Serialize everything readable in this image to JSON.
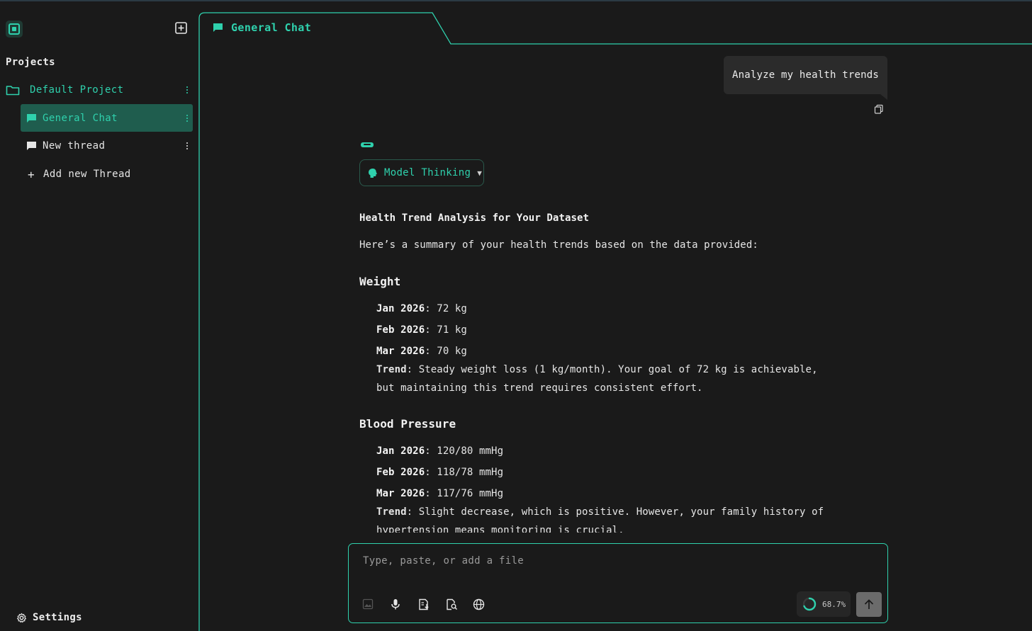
{
  "app": {
    "logo_icon": "chip-icon",
    "new_chat_icon": "add-square-icon",
    "accent_color": "#2fd1ad"
  },
  "sidebar": {
    "projects_heading": "Projects",
    "project": {
      "label": "Default Project",
      "icon": "folder-icon"
    },
    "threads": [
      {
        "label": "General Chat",
        "icon": "chat-bubble-icon",
        "active": true
      },
      {
        "label": "New thread",
        "icon": "chat-bubble-icon",
        "active": false
      }
    ],
    "add_thread_label": "Add new Thread",
    "settings_label": "Settings"
  },
  "tab": {
    "label": "General Chat",
    "icon": "chat-bubble-icon"
  },
  "chat": {
    "user_message": "Analyze my health trends",
    "thinking_label": "Model Thinking",
    "thinking_caret": "▼",
    "response": {
      "title": "Health Trend Analysis for Your Dataset",
      "intro": "Here’s a summary of your health trends based on the data provided:",
      "weight": {
        "heading": "Weight",
        "items": [
          {
            "label": "Jan 2026",
            "value": ": 72 kg"
          },
          {
            "label": "Feb 2026",
            "value": ": 71 kg"
          },
          {
            "label": "Mar 2026",
            "value": ": 70 kg"
          }
        ],
        "trend_label": "Trend",
        "trend_text": ": Steady weight loss (1 kg/month). Your goal of 72 kg is achievable, but maintaining this trend requires consistent effort."
      },
      "blood_pressure": {
        "heading": "Blood Pressure",
        "items": [
          {
            "label": "Jan 2026",
            "value": ": 120/80 mmHg"
          },
          {
            "label": "Feb 2026",
            "value": ": 118/78 mmHg"
          },
          {
            "label": "Mar 2026",
            "value": ": 117/76 mmHg"
          }
        ],
        "trend_label": "Trend",
        "trend_text": ": Slight decrease, which is positive. However, your family history of hypertension means monitoring is crucial."
      }
    }
  },
  "composer": {
    "placeholder": "Type, paste, or add a file",
    "tools": [
      "image-icon",
      "microphone-icon",
      "document-download-icon",
      "document-search-icon",
      "globe-icon"
    ],
    "context_usage": "68.7%",
    "context_usage_value": 0.687,
    "send_icon": "arrow-up-icon"
  }
}
